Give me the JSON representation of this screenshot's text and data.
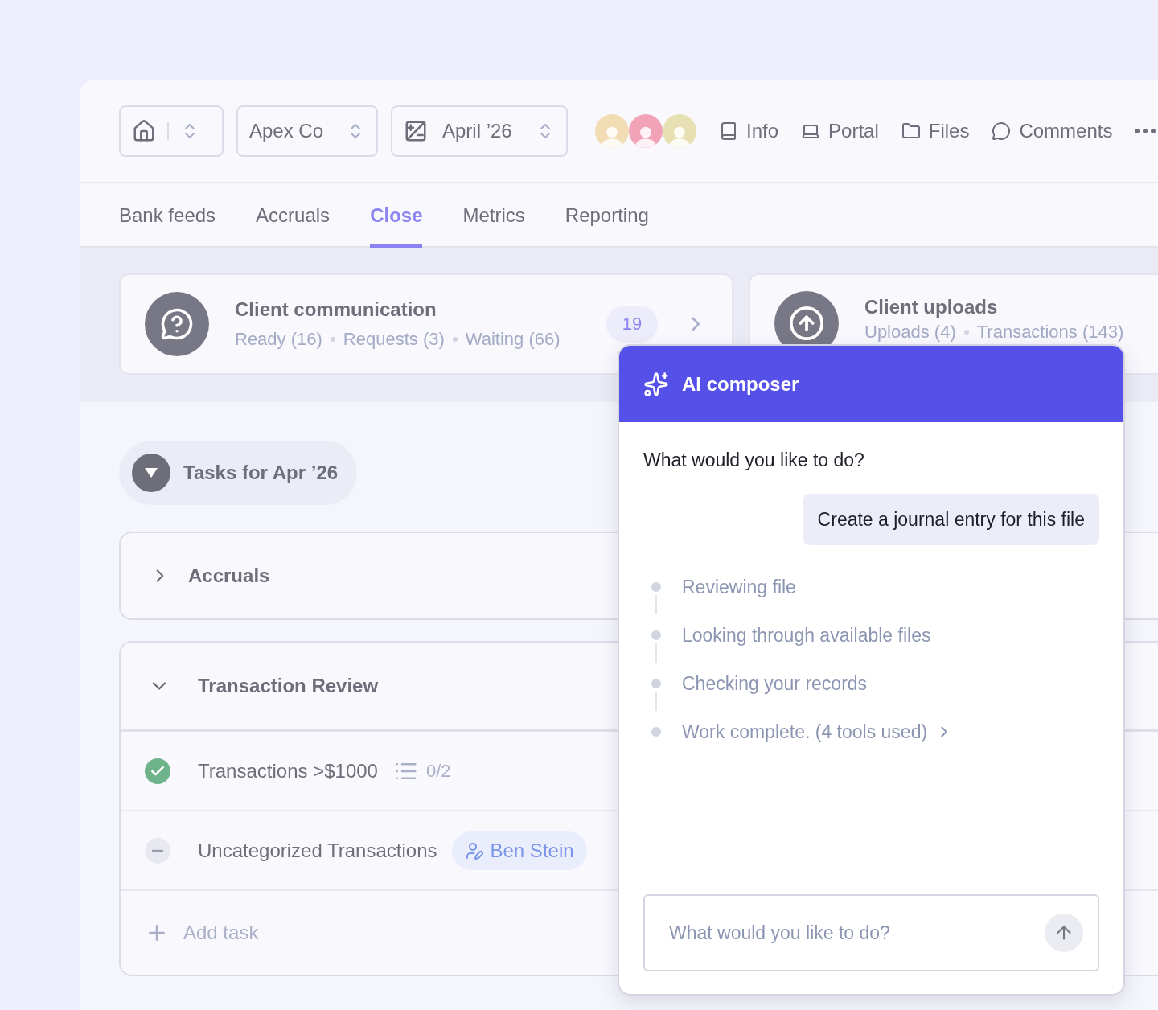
{
  "toolbar": {
    "company": "Apex Co",
    "period": "April ’26",
    "avatars": [
      {
        "color": "#f1dcb4"
      },
      {
        "color": "#f2a3b8"
      },
      {
        "color": "#e6e0b2"
      }
    ],
    "links": [
      {
        "label": "Info",
        "kind": "book"
      },
      {
        "label": "Portal",
        "kind": "laptop"
      },
      {
        "label": "Files",
        "kind": "folder"
      },
      {
        "label": "Comments",
        "kind": "comment"
      }
    ]
  },
  "tabs": [
    {
      "label": "Bank feeds",
      "selected": false
    },
    {
      "label": "Accruals",
      "selected": false
    },
    {
      "label": "Close",
      "selected": true
    },
    {
      "label": "Metrics",
      "selected": false
    },
    {
      "label": "Reporting",
      "selected": false
    }
  ],
  "summary_cards": [
    {
      "kind": "question",
      "title": "Client communication",
      "stats": [
        "Ready (16)",
        "Requests (3)",
        "Waiting (66)"
      ],
      "count": "19"
    },
    {
      "kind": "upload",
      "title": "Client uploads",
      "stats": [
        "Uploads (4)",
        "Transactions (143)"
      ]
    }
  ],
  "tasks_toggle": {
    "label": "Tasks for Apr ’26",
    "expanded": true
  },
  "groups": [
    {
      "title": "Accruals",
      "expanded": false
    },
    {
      "title": "Transaction Review",
      "expanded": true,
      "tasks": [
        {
          "kind": "done",
          "title": "Transactions >$1000",
          "subtasks": "0/2"
        },
        {
          "kind": "skipped",
          "title": "Uncategorized Transactions",
          "assignee": "Ben Stein"
        }
      ],
      "add_label": "Add task"
    }
  ],
  "composer": {
    "title": "AI composer",
    "prompt": "What would you like to do?",
    "message": "Create a journal entry for this file",
    "steps": [
      {
        "label": "Reviewing file",
        "expandable": false
      },
      {
        "label": "Looking through available files",
        "expandable": false
      },
      {
        "label": "Checking your records",
        "expandable": false
      },
      {
        "label": "Work complete. (4 tools used)",
        "expandable": true
      }
    ],
    "input": {
      "placeholder": "What would you like to do?"
    }
  }
}
